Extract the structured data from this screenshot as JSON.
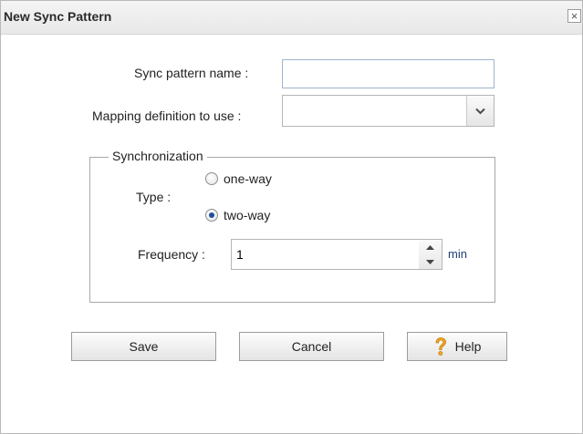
{
  "dialog": {
    "title": "New Sync Pattern",
    "close_glyph": "×"
  },
  "form": {
    "sync_pattern_name_label": "Sync pattern name :",
    "sync_pattern_name_value": "",
    "mapping_definition_label": "Mapping definition to use :",
    "mapping_definition_value": ""
  },
  "synchronization": {
    "legend": "Synchronization",
    "type_label": "Type :",
    "options": [
      {
        "label": "one-way",
        "checked": false
      },
      {
        "label": "two-way",
        "checked": true
      }
    ],
    "frequency_label": "Frequency :",
    "frequency_value": "1",
    "frequency_unit": "min"
  },
  "buttons": {
    "save": "Save",
    "cancel": "Cancel",
    "help": "Help"
  },
  "icons": {
    "close": "close-icon",
    "dropdown": "chevron-down-icon",
    "spin_up": "arrow-up-icon",
    "spin_down": "arrow-down-icon",
    "help": "question-mark-icon"
  },
  "colors": {
    "help_icon": "#f5a623",
    "unit_text": "#1f3d7a",
    "radio_dot": "#1d4f9a"
  }
}
